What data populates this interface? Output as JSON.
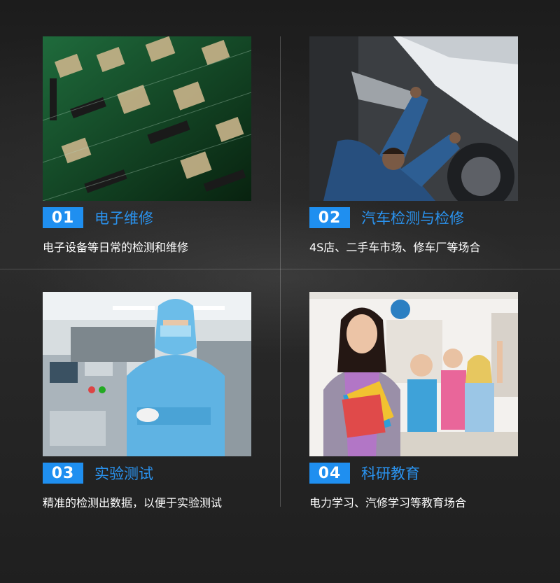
{
  "cards": [
    {
      "num": "01",
      "title": "电子维修",
      "desc": "电子设备等日常的检测和维修",
      "image": "circuit-board-photo"
    },
    {
      "num": "02",
      "title": "汽车检测与检修",
      "desc": "4S店、二手车市场、修车厂等场合",
      "image": "car-mechanic-photo"
    },
    {
      "num": "03",
      "title": "实验测试",
      "desc": "精准的检测出数据，以便于实验测试",
      "image": "cleanroom-worker-photo"
    },
    {
      "num": "04",
      "title": "科研教育",
      "desc": "电力学习、汽修学习等教育场合",
      "image": "classroom-teacher-photo"
    }
  ],
  "colors": {
    "accent": "#1f8ff0",
    "title": "#2a93ef",
    "background": "#222222"
  }
}
